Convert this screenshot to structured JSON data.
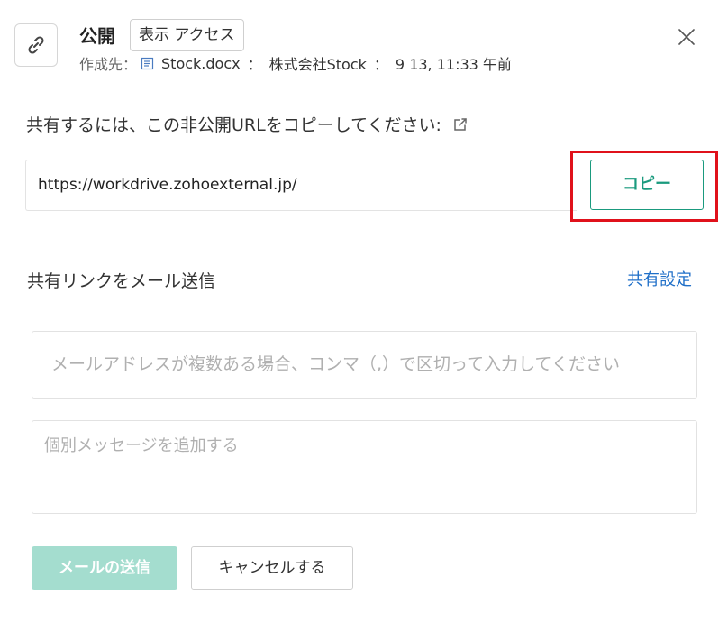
{
  "header": {
    "title": "公開",
    "access_badge": "表示 アクセス",
    "created_in_label": "作成先：",
    "file_name": "Stock.docx",
    "separator": "：",
    "workspace": "株式会社Stock",
    "timestamp": "9 13, 11:33 午前",
    "icons": {
      "link": "link-icon",
      "document": "document-icon",
      "close": "close-icon"
    }
  },
  "copy_section": {
    "instruction": "共有するには、この非公開URLをコピーしてください:",
    "external_icon": "external-link-icon",
    "url": "https://workdrive.zohoexternal.jp/",
    "copy_label": "コピー"
  },
  "email_section": {
    "heading": "共有リンクをメール送信",
    "settings_link": "共有設定",
    "email_placeholder": "メールアドレスが複数ある場合、コンマ（,）で区切って入力してください",
    "message_placeholder": "個別メッセージを追加する",
    "send_label": "メールの送信",
    "cancel_label": "キャンセルする"
  },
  "colors": {
    "accent": "#1a9a7e",
    "accent_disabled": "#a4ddcf",
    "link": "#1f6fc8",
    "highlight": "#e0111b"
  }
}
